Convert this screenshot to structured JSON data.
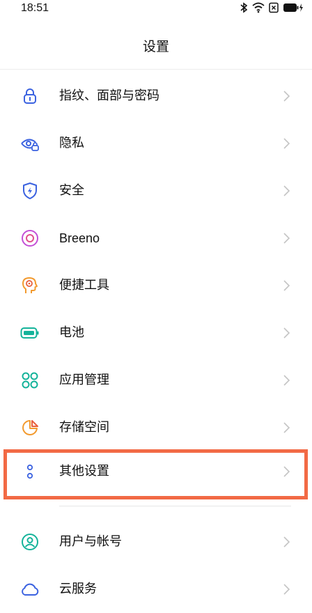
{
  "status_bar": {
    "time": "18:51",
    "icons": [
      "bluetooth-icon",
      "wifi-icon",
      "sim-off-icon",
      "battery-charging-icon"
    ]
  },
  "header": {
    "title": "设置"
  },
  "colors": {
    "highlight_border": "#f26a45",
    "chevron": "#c4c4c4"
  },
  "settings": {
    "items": [
      {
        "label": "指纹、面部与密码",
        "icon": "lock-icon",
        "color": "#3b62e0"
      },
      {
        "label": "隐私",
        "icon": "eye-lock-icon",
        "color": "#3b62e0"
      },
      {
        "label": "安全",
        "icon": "shield-bolt-icon",
        "color": "#3b62e0"
      },
      {
        "label": "Breeno",
        "icon": "breeno-icon",
        "color": "#c44fd6"
      },
      {
        "label": "便捷工具",
        "icon": "head-target-icon",
        "color": "#f29a2e"
      },
      {
        "label": "电池",
        "icon": "battery-icon",
        "color": "#14b39a"
      },
      {
        "label": "应用管理",
        "icon": "apps-grid-icon",
        "color": "#14b39a"
      },
      {
        "label": "存储空间",
        "icon": "pie-storage-icon",
        "color": "#f29a2e"
      },
      {
        "label": "其他设置",
        "icon": "more-dots-icon",
        "color": "#3b62e0"
      },
      {
        "label": "用户与帐号",
        "icon": "user-circle-icon",
        "color": "#14b39a"
      },
      {
        "label": "云服务",
        "icon": "cloud-icon",
        "color": "#3b62e0"
      }
    ]
  }
}
